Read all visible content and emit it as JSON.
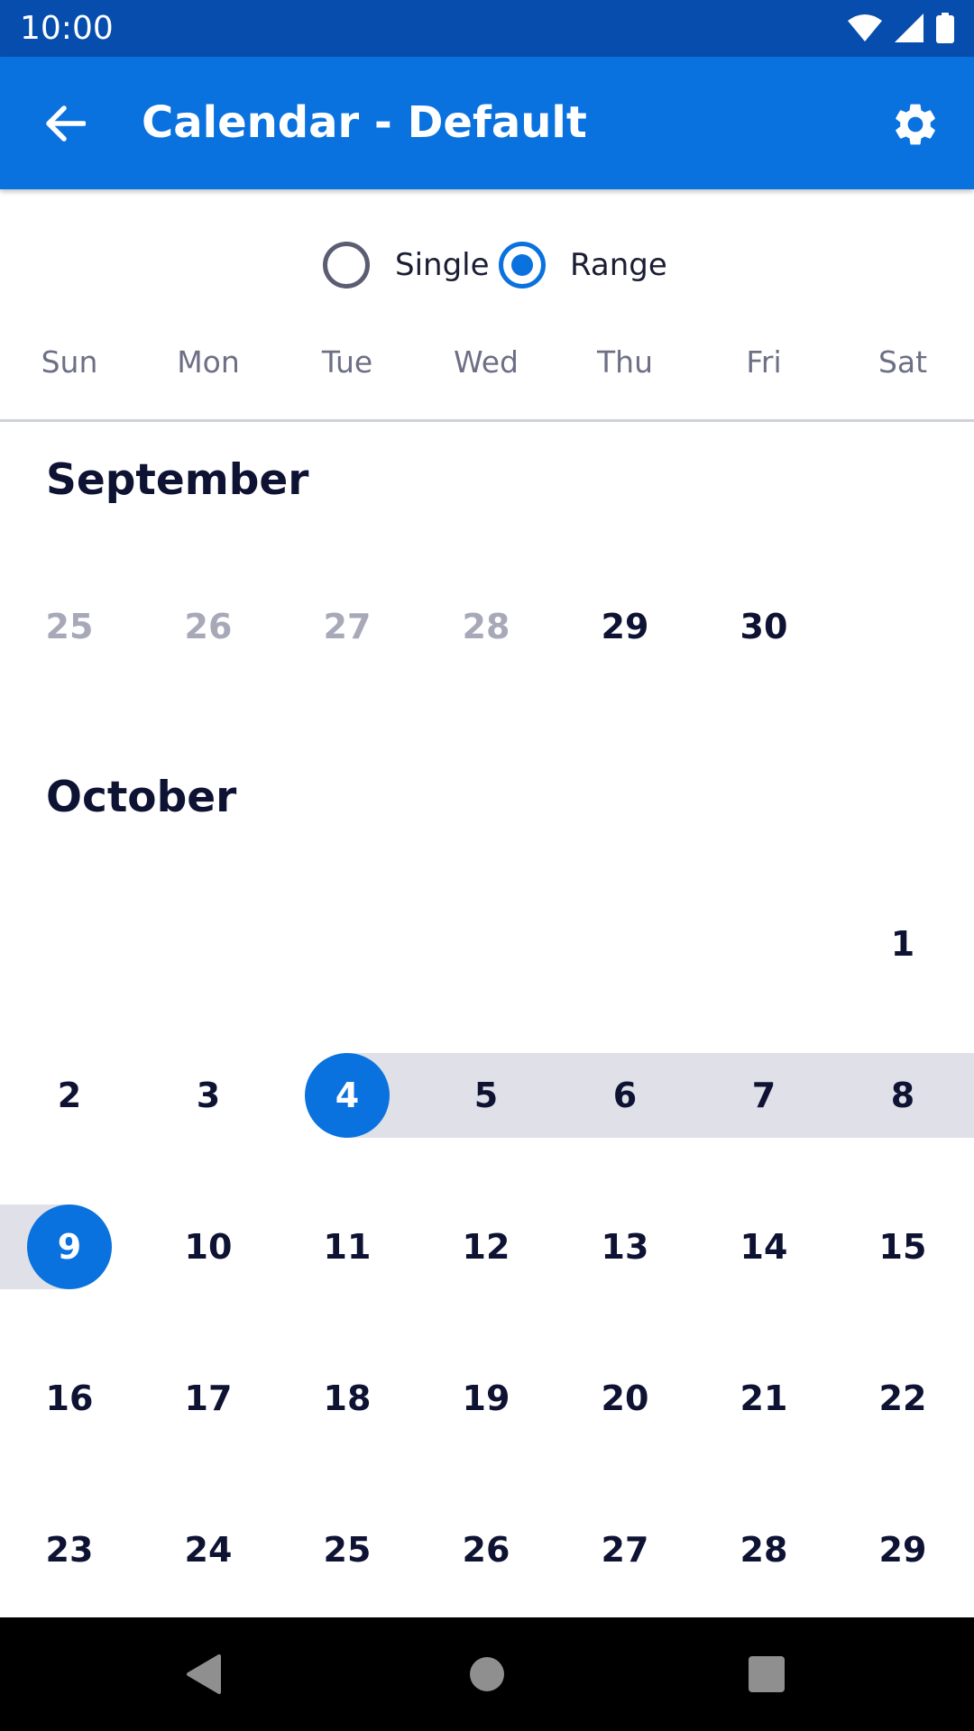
{
  "status_bar": {
    "time": "10:00",
    "icons": [
      "wifi-icon",
      "cellular-signal-icon",
      "battery-icon"
    ]
  },
  "app_bar": {
    "title": "Calendar - Default",
    "back_icon": "arrow-back-icon",
    "settings_icon": "gear-icon"
  },
  "mode_toggle": {
    "options": [
      {
        "label": "Single",
        "checked": false
      },
      {
        "label": "Range",
        "checked": true
      }
    ]
  },
  "weekdays": [
    "Sun",
    "Mon",
    "Tue",
    "Wed",
    "Thu",
    "Fri",
    "Sat"
  ],
  "months": [
    {
      "name": "September",
      "weeks": [
        [
          {
            "day": "25",
            "state": "outside"
          },
          {
            "day": "26",
            "state": "outside"
          },
          {
            "day": "27",
            "state": "outside"
          },
          {
            "day": "28",
            "state": "outside"
          },
          {
            "day": "29",
            "state": "normal"
          },
          {
            "day": "30",
            "state": "normal"
          },
          null
        ]
      ]
    },
    {
      "name": "October",
      "weeks": [
        [
          null,
          null,
          null,
          null,
          null,
          null,
          {
            "day": "1",
            "state": "normal"
          }
        ],
        [
          {
            "day": "2",
            "state": "normal"
          },
          {
            "day": "3",
            "state": "normal"
          },
          {
            "day": "4",
            "state": "range-start"
          },
          {
            "day": "5",
            "state": "in-range"
          },
          {
            "day": "6",
            "state": "in-range"
          },
          {
            "day": "7",
            "state": "in-range"
          },
          {
            "day": "8",
            "state": "in-range"
          }
        ],
        [
          {
            "day": "9",
            "state": "range-end"
          },
          {
            "day": "10",
            "state": "normal"
          },
          {
            "day": "11",
            "state": "normal"
          },
          {
            "day": "12",
            "state": "normal"
          },
          {
            "day": "13",
            "state": "normal"
          },
          {
            "day": "14",
            "state": "normal"
          },
          {
            "day": "15",
            "state": "normal"
          }
        ],
        [
          {
            "day": "16",
            "state": "normal"
          },
          {
            "day": "17",
            "state": "normal"
          },
          {
            "day": "18",
            "state": "normal"
          },
          {
            "day": "19",
            "state": "normal"
          },
          {
            "day": "20",
            "state": "normal"
          },
          {
            "day": "21",
            "state": "normal"
          },
          {
            "day": "22",
            "state": "normal"
          }
        ],
        [
          {
            "day": "23",
            "state": "normal"
          },
          {
            "day": "24",
            "state": "normal"
          },
          {
            "day": "25",
            "state": "normal"
          },
          {
            "day": "26",
            "state": "normal"
          },
          {
            "day": "27",
            "state": "normal"
          },
          {
            "day": "28",
            "state": "normal"
          },
          {
            "day": "29",
            "state": "normal"
          }
        ]
      ]
    }
  ],
  "nav_bar": {
    "buttons": [
      "back-triangle-icon",
      "home-circle-icon",
      "recents-square-icon"
    ]
  },
  "colors": {
    "status_bar": "#074dad",
    "app_bar": "#0a72de",
    "accent": "#0a72de",
    "range_fill": "#dfe0e8",
    "text": "#0f1333",
    "muted": "#a7a9b8"
  }
}
